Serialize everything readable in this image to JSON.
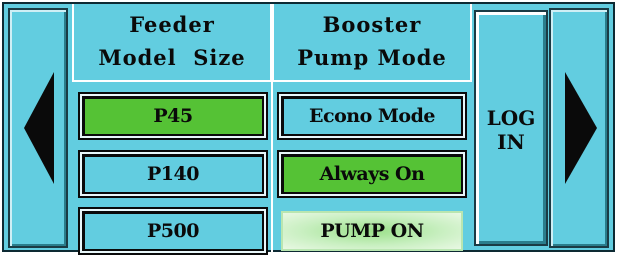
{
  "columns": {
    "feeder": {
      "header_line1": "Feeder",
      "header_line2": "Model  Size"
    },
    "booster": {
      "header_line1": "Booster",
      "header_line2": "Pump Mode"
    }
  },
  "feeder_model_sizes": [
    {
      "label": "P45",
      "state": "selected",
      "color": "#55c235"
    },
    {
      "label": "P140",
      "state": "normal",
      "color": "#62cde0"
    },
    {
      "label": "P500",
      "state": "normal",
      "color": "#62cde0"
    }
  ],
  "booster_pump_modes": [
    {
      "label": "Econo Mode",
      "state": "normal",
      "color": "#62cde0"
    },
    {
      "label": "Always On",
      "state": "selected",
      "color": "#55c235"
    },
    {
      "label": "PUMP ON",
      "state": "indicator",
      "color": "#9be08a"
    }
  ],
  "login": {
    "line1": "LOG",
    "line2": "IN"
  },
  "nav": {
    "prev_icon": "left-arrow-icon",
    "next_icon": "right-arrow-icon"
  },
  "theme": {
    "panel": "#62cde0",
    "selected": "#55c235",
    "border": "#0a0a0a"
  }
}
